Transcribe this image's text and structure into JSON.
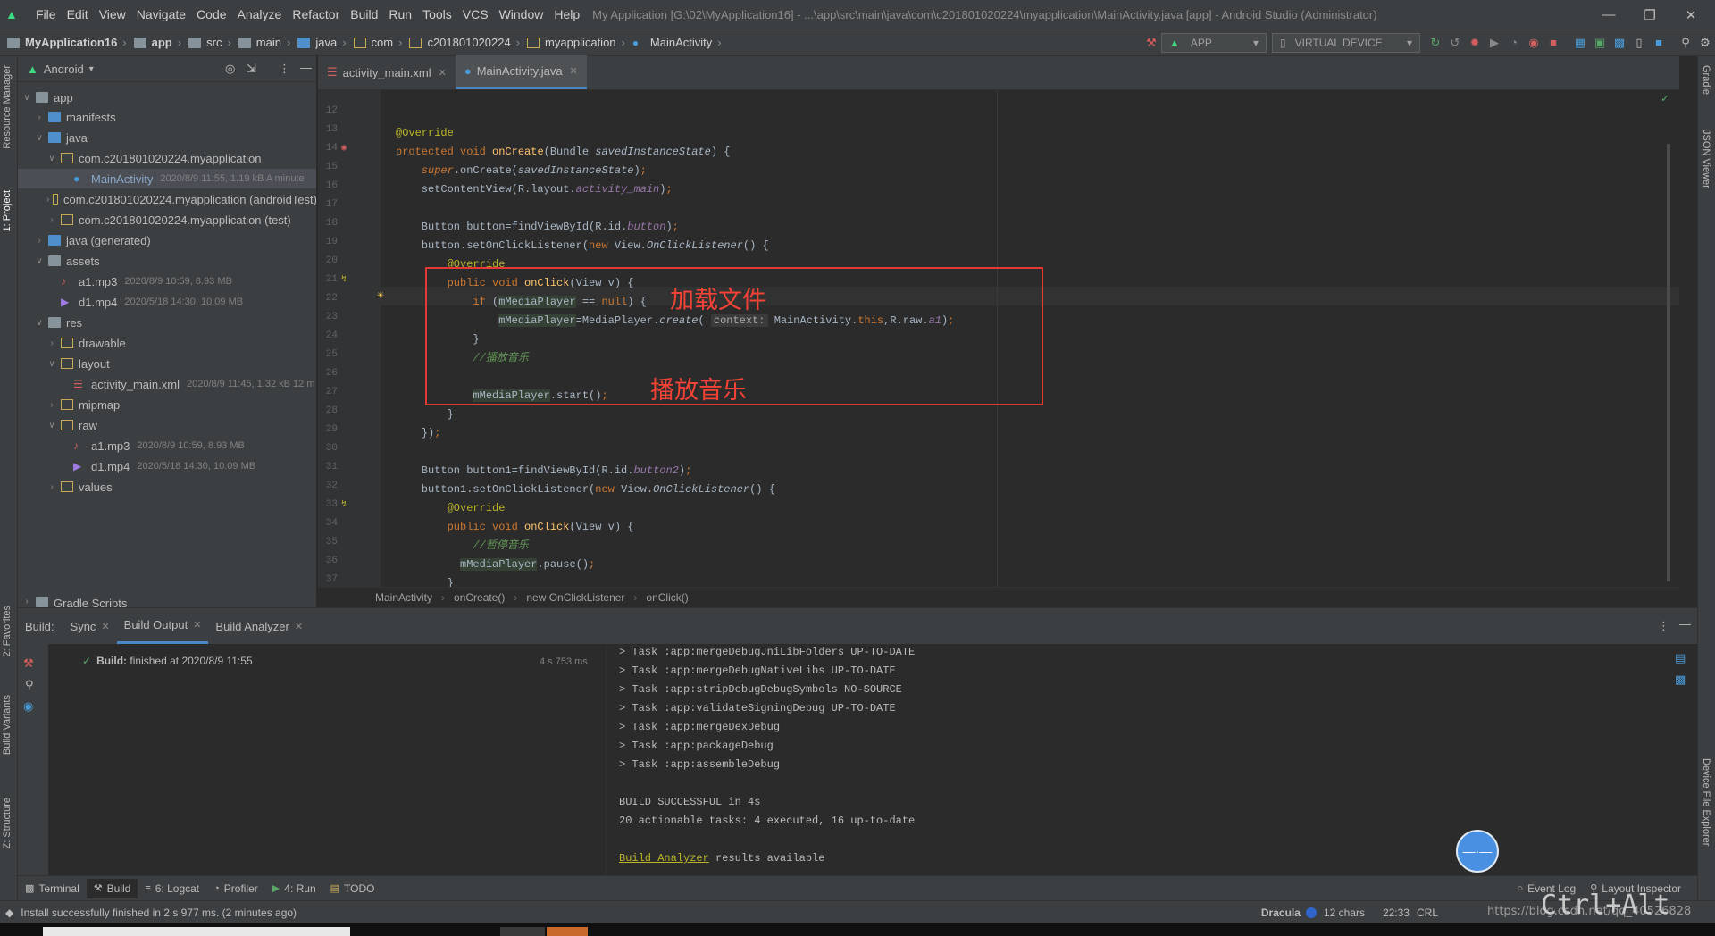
{
  "window": {
    "title": "My Application [G:\\02\\MyApplication16] - ...\\app\\src\\main\\java\\com\\c201801020224\\myapplication\\MainActivity.java [app] - Android Studio (Administrator)",
    "menu": [
      "File",
      "Edit",
      "View",
      "Navigate",
      "Code",
      "Analyze",
      "Refactor",
      "Build",
      "Run",
      "Tools",
      "VCS",
      "Window",
      "Help"
    ]
  },
  "navbar": {
    "crumbs": [
      "MyApplication16",
      "app",
      "src",
      "main",
      "java",
      "com",
      "c201801020224",
      "myapplication",
      "MainActivity"
    ],
    "run_config": "APP",
    "device": "VIRTUAL DEVICE"
  },
  "left_stripe": {
    "resource_manager": "Resource Manager",
    "project": "1: Project",
    "favorites": "2: Favorites",
    "build_variants": "Build Variants",
    "structure": "Z: Structure"
  },
  "right_stripe": {
    "gradle": "Gradle",
    "json_viewer": "JSON Viewer",
    "device_file_explorer": "Device File Explorer"
  },
  "project": {
    "view_mode": "Android",
    "tree": [
      {
        "label": "app",
        "meta": ""
      },
      {
        "label": "manifests",
        "meta": ""
      },
      {
        "label": "java",
        "meta": ""
      },
      {
        "label": "com.c201801020224.myapplication",
        "meta": ""
      },
      {
        "label": "MainActivity",
        "meta": "2020/8/9 11:55, 1.19 kB  A minute"
      },
      {
        "label": "com.c201801020224.myapplication (androidTest)",
        "meta": ""
      },
      {
        "label": "com.c201801020224.myapplication (test)",
        "meta": ""
      },
      {
        "label": "java (generated)",
        "meta": ""
      },
      {
        "label": "assets",
        "meta": ""
      },
      {
        "label": "a1.mp3",
        "meta": "2020/8/9 10:59, 8.93 MB"
      },
      {
        "label": "d1.mp4",
        "meta": "2020/5/18 14:30, 10.09 MB"
      },
      {
        "label": "res",
        "meta": ""
      },
      {
        "label": "drawable",
        "meta": ""
      },
      {
        "label": "layout",
        "meta": ""
      },
      {
        "label": "activity_main.xml",
        "meta": "2020/8/9 11:45, 1.32 kB  12 m"
      },
      {
        "label": "mipmap",
        "meta": ""
      },
      {
        "label": "raw",
        "meta": ""
      },
      {
        "label": "a1.mp3",
        "meta": "2020/8/9 10:59, 8.93 MB"
      },
      {
        "label": "d1.mp4",
        "meta": "2020/5/18 14:30, 10.09 MB"
      },
      {
        "label": "values",
        "meta": ""
      },
      {
        "label": "Gradle Scripts",
        "meta": ""
      }
    ]
  },
  "editor": {
    "tabs": [
      "activity_main.xml",
      "MainActivity.java"
    ],
    "line_numbers": [
      "12",
      "13",
      "14",
      "15",
      "16",
      "17",
      "18",
      "19",
      "20",
      "21",
      "22",
      "23",
      "24",
      "25",
      "26",
      "27",
      "28",
      "29",
      "30",
      "31",
      "32",
      "33",
      "34",
      "35",
      "36",
      "37"
    ],
    "annotations": [
      "加载文件",
      "播放音乐"
    ],
    "breadcrumb": [
      "MainActivity",
      "onCreate()",
      "new OnClickListener",
      "onClick()"
    ]
  },
  "build": {
    "label": "Build:",
    "tabs": [
      "Sync",
      "Build Output",
      "Build Analyzer"
    ],
    "tree_status": "Build:",
    "tree_status_rest": "finished at 2020/8/9 11:55",
    "tree_duration": "4 s 753 ms",
    "log": [
      "> Task :app:mergeDebugJniLibFolders UP-TO-DATE",
      "> Task :app:mergeDebugNativeLibs UP-TO-DATE",
      "> Task :app:stripDebugDebugSymbols NO-SOURCE",
      "> Task :app:validateSigningDebug UP-TO-DATE",
      "> Task :app:mergeDexDebug",
      "> Task :app:packageDebug",
      "> Task :app:assembleDebug",
      "",
      "BUILD SUCCESSFUL in 4s",
      "20 actionable tasks: 4 executed, 16 up-to-date"
    ],
    "analyzer_link": "Build Analyzer",
    "analyzer_rest": " results available"
  },
  "bottom_tools": [
    "Terminal",
    "Build",
    "6: Logcat",
    "Profiler",
    "4: Run",
    "TODO"
  ],
  "bottom_right": [
    "Event Log",
    "Layout Inspector"
  ],
  "status": {
    "message": "Install successfully finished in 2 s 977 ms. (2 minutes ago)",
    "theme": "Dracula",
    "chars": "12 chars",
    "position": "22:33",
    "encoding": "CRL",
    "key_overlay": "Ctrl+Alt",
    "watermark": "https://blog.csdn.net/qq_40526828"
  }
}
